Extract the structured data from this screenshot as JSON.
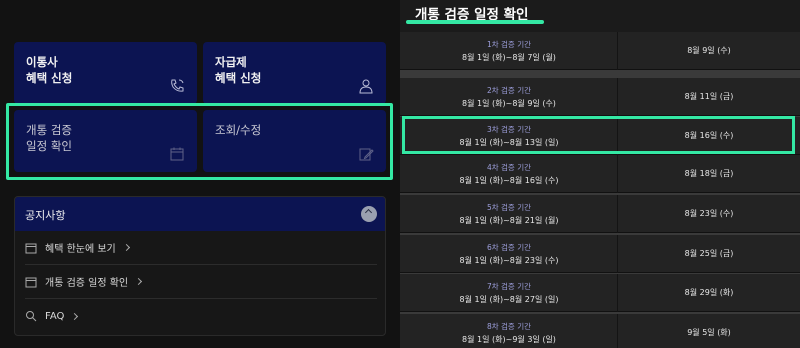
{
  "tiles": [
    {
      "title": "이통사\n혜택 신청",
      "icon": "phone-icon"
    },
    {
      "title": "자급제\n혜택 신청",
      "icon": "user-icon"
    },
    {
      "title": "개통 검증\n일정 확인",
      "icon": "calendar-icon"
    },
    {
      "title": "조회/수정",
      "icon": "edit-icon"
    }
  ],
  "notice": {
    "title": "공지사항",
    "items": [
      {
        "label": "혜택 한눈에 보기",
        "icon": "calendar-icon"
      },
      {
        "label": "개통 검증 일정 확인",
        "icon": "calendar-icon"
      },
      {
        "label": "FAQ",
        "icon": "search-icon"
      }
    ]
  },
  "schedule": {
    "title": "개통 검증 일정 확인",
    "rows": [
      {
        "label": "1차 검증 기간",
        "range": "8월 1일 (화)~8월 7일 (월)",
        "date": "8월 9일 (수)"
      },
      {
        "label": "2차 검증 기간",
        "range": "8월 1일 (화)~8월 9일 (수)",
        "date": "8월 11일 (금)"
      },
      {
        "label": "3차 검증 기간",
        "range": "8월 1일 (화)~8월 13일 (일)",
        "date": "8월 16일 (수)"
      },
      {
        "label": "4차 검증 기간",
        "range": "8월 1일 (화)~8월 16일 (수)",
        "date": "8월 18일 (금)"
      },
      {
        "label": "5차 검증 기간",
        "range": "8월 1일 (화)~8월 21일 (월)",
        "date": "8월 23일 (수)"
      },
      {
        "label": "6차 검증 기간",
        "range": "8월 1일 (화)~8월 23일 (수)",
        "date": "8월 25일 (금)"
      },
      {
        "label": "7차 검증 기간",
        "range": "8월 1일 (화)~8월 27일 (일)",
        "date": "8월 29일 (화)"
      },
      {
        "label": "8차 검증 기간",
        "range": "8월 1일 (화)~9월 3일 (일)",
        "date": "9월 5일 (화)"
      }
    ]
  },
  "colors": {
    "tile_bg": "#0c1452",
    "highlight": "#34e8a4",
    "label_purple": "#9d9fdc"
  }
}
